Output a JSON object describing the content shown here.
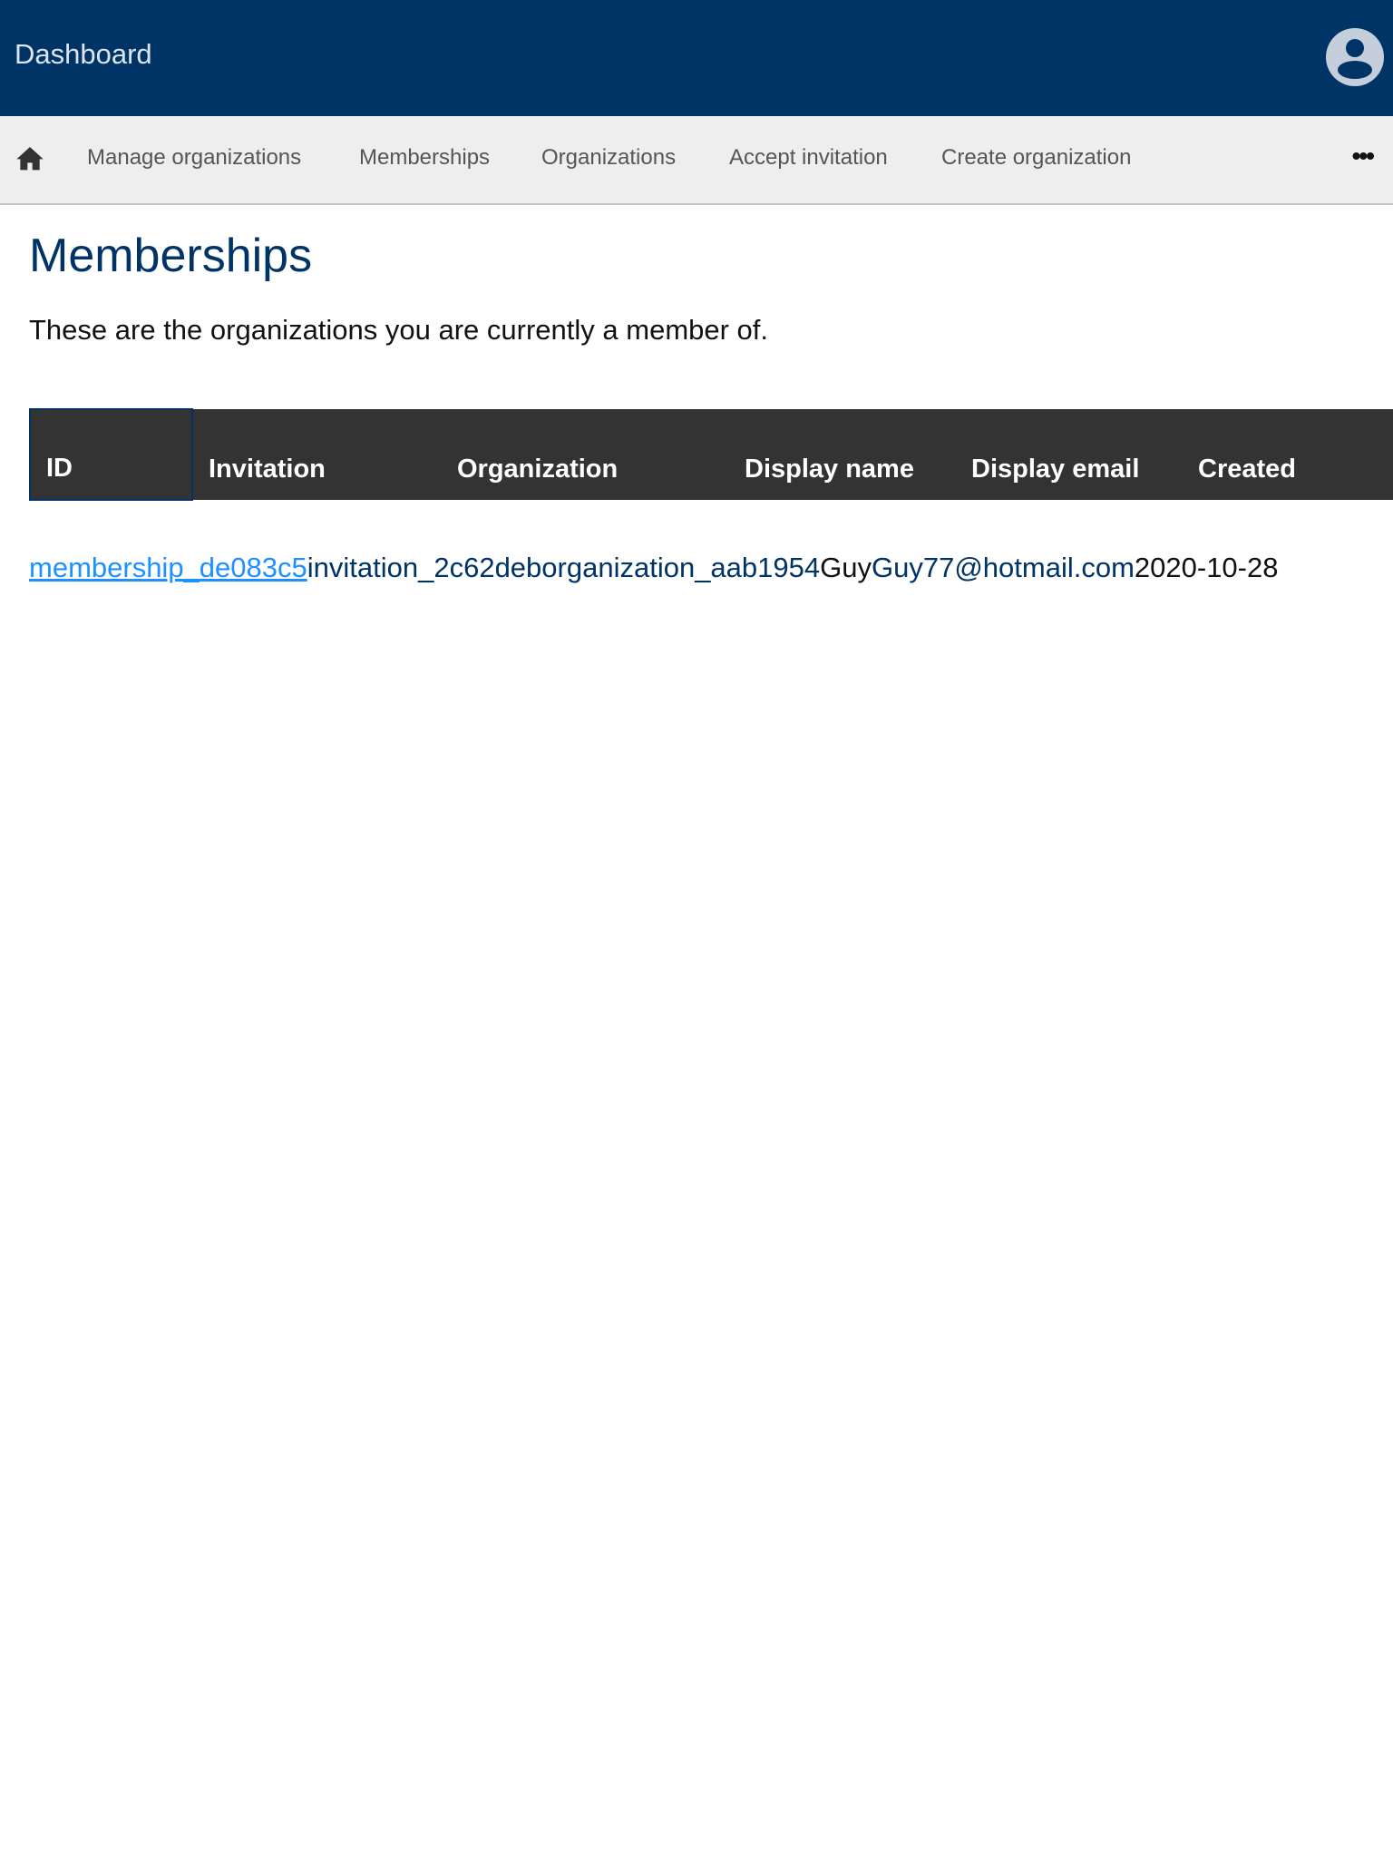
{
  "header": {
    "title": "Dashboard",
    "avatar_icon": "user-circle-icon"
  },
  "nav": {
    "home_icon": "home-icon",
    "items": [
      "Manage organizations",
      "Memberships",
      "Organizations",
      "Accept invitation",
      "Create organization"
    ],
    "more": "•••"
  },
  "page": {
    "title": "Memberships",
    "intro": "These are the organizations you are currently a member of."
  },
  "table": {
    "headers": {
      "id": "ID",
      "invitation": "Invitation",
      "organization": "Organization",
      "display_name": "Display name",
      "display_email": "Display email",
      "created": "Created"
    },
    "rows": [
      {
        "id": "membership_de083c5",
        "invitation": "invitation_2c62deb",
        "organization": "organization_aab1954",
        "display_name": "Guy",
        "display_email": "Guy77@hotmail.com",
        "created": "2020-10-28"
      }
    ]
  }
}
